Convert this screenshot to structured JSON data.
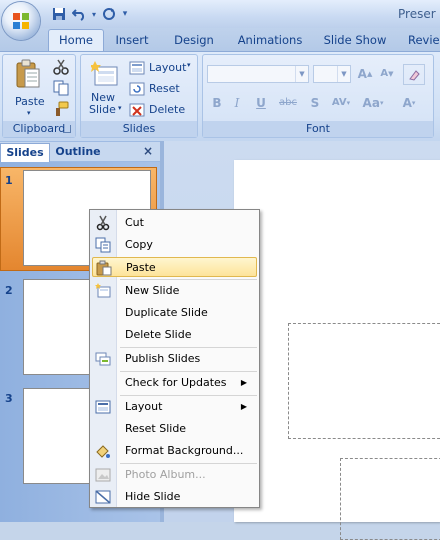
{
  "window": {
    "title": "Preser"
  },
  "qat": {
    "save": "save-icon",
    "undo": "undo-icon",
    "redo": "redo-icon",
    "more": "▾"
  },
  "tabs": [
    "Home",
    "Insert",
    "Design",
    "Animations",
    "Slide Show",
    "Revie"
  ],
  "ribbon": {
    "clipboard": {
      "paste": "Paste",
      "label": "Clipboard"
    },
    "slides": {
      "new_slide_line1": "New",
      "new_slide_line2": "Slide",
      "layout": "Layout",
      "reset": "Reset",
      "delete": "Delete",
      "label": "Slides"
    },
    "font": {
      "label": "Font",
      "bold": "B",
      "italic": "I",
      "underline": "U",
      "strike": "abc",
      "shadow": "S",
      "spacing": "AV",
      "case": "Aa",
      "color": "A",
      "grow": "A",
      "shrink": "A"
    }
  },
  "pane": {
    "tab_slides": "Slides",
    "tab_outline": "Outline",
    "close": "×",
    "slide_numbers": [
      "1",
      "2",
      "3"
    ]
  },
  "context_menu": {
    "items": [
      {
        "label": "Cut",
        "icon": "scissors-icon"
      },
      {
        "label": "Copy",
        "icon": "copy-icon"
      },
      {
        "label": "Paste",
        "icon": "paste-icon",
        "highlighted": true
      },
      {
        "label": "New Slide",
        "icon": "new-slide-icon"
      },
      {
        "label": "Duplicate Slide"
      },
      {
        "label": "Delete Slide"
      },
      {
        "label": "Publish Slides",
        "icon": "publish-icon"
      },
      {
        "label": "Check for Updates",
        "submenu": true
      },
      {
        "label": "Layout",
        "icon": "layout-icon",
        "submenu": true
      },
      {
        "label": "Reset Slide"
      },
      {
        "label": "Format Background...",
        "icon": "format-background-icon"
      },
      {
        "label": "Photo Album...",
        "icon": "photo-album-icon",
        "disabled": true
      },
      {
        "label": "Hide Slide",
        "icon": "hide-slide-icon"
      }
    ]
  }
}
